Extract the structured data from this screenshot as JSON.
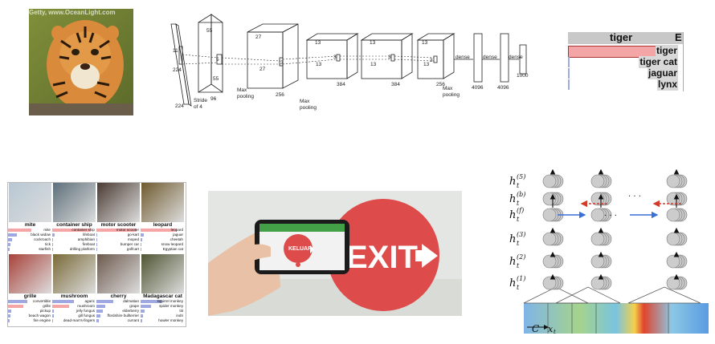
{
  "tiger_photo": {
    "watermark": "Getty, www.OceanLight.com"
  },
  "alexnet": {
    "input_size_h": "224",
    "input_size_w": "224",
    "kernel1": "11",
    "stride_text": "Stride",
    "stride_of": "of 4",
    "l1_depth": "96",
    "l1_size": "55",
    "l1_size2": "55",
    "l1_k": "5",
    "pool": "Max",
    "pool2": "pooling",
    "l2_size": "27",
    "l2_size2": "27",
    "l2_depth": "256",
    "l2_k": "3",
    "l3_size": "13",
    "l3_size2": "13",
    "l3_depth": "384",
    "l4_depth": "384",
    "l5_depth": "256",
    "dense": "dense",
    "fc1": "4096",
    "fc2": "4096",
    "fc3": "1000"
  },
  "prediction": {
    "header": "tiger",
    "header_cut": "E",
    "items": [
      {
        "label": "tiger",
        "fraction": 0.92,
        "color": "#f4a6a6"
      },
      {
        "label": "tiger cat",
        "fraction": 0.01,
        "color": "#9fa8e0"
      },
      {
        "label": "jaguar",
        "fraction": 0.0,
        "color": "#9fa8e0"
      },
      {
        "label": "lynx",
        "fraction": 0.0,
        "color": "#9fa8e0"
      }
    ]
  },
  "grid": {
    "cells": [
      {
        "title": "mite",
        "items": [
          "mite",
          "black widow",
          "cockroach",
          "tick",
          "starfish"
        ],
        "scores": [
          0.55,
          0.2,
          0.1,
          0.06,
          0.04
        ],
        "img_color": "#b7c7d3"
      },
      {
        "title": "container ship",
        "items": [
          "container ship",
          "lifeboat",
          "amphibian",
          "fireboat",
          "drilling platform"
        ],
        "scores": [
          0.9,
          0.05,
          0.02,
          0.01,
          0.01
        ],
        "img_color": "#5e6f7a"
      },
      {
        "title": "motor scooter",
        "items": [
          "motor scooter",
          "go-kart",
          "moped",
          "bumper car",
          "golfcart"
        ],
        "scores": [
          0.95,
          0.02,
          0.01,
          0.01,
          0.01
        ],
        "img_color": "#4a3b32"
      },
      {
        "title": "leopard",
        "items": [
          "leopard",
          "jaguar",
          "cheetah",
          "snow leopard",
          "Egyptian cat"
        ],
        "scores": [
          0.85,
          0.08,
          0.03,
          0.02,
          0.01
        ],
        "img_color": "#6f5a2e"
      },
      {
        "title": "grille",
        "items": [
          "convertible",
          "grille",
          "pickup",
          "beach wagon",
          "fire engine"
        ],
        "scores": [
          0.45,
          0.35,
          0.08,
          0.06,
          0.04
        ],
        "img_color": "#a8423a"
      },
      {
        "title": "mushroom",
        "items": [
          "agaric",
          "mushroom",
          "jelly fungus",
          "gill fungus",
          "dead-man's-fingers"
        ],
        "scores": [
          0.5,
          0.4,
          0.04,
          0.03,
          0.02
        ],
        "img_color": "#7a6a38"
      },
      {
        "title": "cherry",
        "items": [
          "dalmatian",
          "grape",
          "elderberry",
          "ffordshire bullterrier",
          "currant"
        ],
        "scores": [
          0.4,
          0.2,
          0.15,
          0.1,
          0.05
        ],
        "img_color": "#6d5a4e"
      },
      {
        "title": "Madagascar cat",
        "items": [
          "squirrel monkey",
          "spider monkey",
          "titi",
          "indri",
          "howler monkey"
        ],
        "scores": [
          0.5,
          0.25,
          0.1,
          0.06,
          0.04
        ],
        "img_color": "#4f5533"
      }
    ]
  },
  "exit_photo": {
    "sign_text": "EXIT",
    "phone_text": "KELUAR"
  },
  "rnn": {
    "labels": [
      "h",
      "h",
      "h",
      "h",
      "h",
      "h"
    ],
    "sups": [
      "(5)",
      "(b)",
      "(f)",
      "(3)",
      "(2)",
      "(1)"
    ],
    "sub": "t",
    "dots": "· · ·",
    "c_label": "C",
    "x_label": "x",
    "x_sub": "t"
  },
  "colors": {
    "pred_top": "#f4a6a6",
    "pred_other": "#9fa8e0",
    "header_gray": "#c8c8c8",
    "exit_red": "#dd4b4b"
  }
}
